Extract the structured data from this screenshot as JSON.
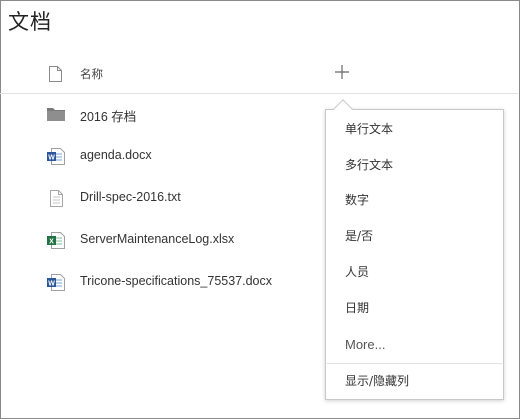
{
  "page": {
    "title": "文档"
  },
  "header": {
    "name_label": "名称",
    "add_column_icon": "plus-icon"
  },
  "files": [
    {
      "name": "2016 存档",
      "icon": "folder-icon",
      "icon_color": "#7a7a7a"
    },
    {
      "name": "agenda.docx",
      "icon": "word-doc-icon",
      "icon_color": "#2b579a"
    },
    {
      "name": "Drill-spec-2016.txt",
      "icon": "text-file-icon",
      "icon_color": "#b0b0b0"
    },
    {
      "name": "ServerMaintenanceLog.xlsx",
      "icon": "excel-doc-icon",
      "icon_color": "#217346"
    },
    {
      "name": "Tricone-specifications_75537.docx",
      "icon": "word-doc-icon",
      "icon_color": "#2b579a"
    }
  ],
  "column_menu": {
    "items": [
      {
        "label": "单行文本"
      },
      {
        "label": "多行文本"
      },
      {
        "label": "数字"
      },
      {
        "label": "是/否"
      },
      {
        "label": "人员"
      },
      {
        "label": "日期"
      },
      {
        "label": "More..."
      }
    ],
    "footer_item": {
      "label": "显示/隐藏列"
    }
  }
}
